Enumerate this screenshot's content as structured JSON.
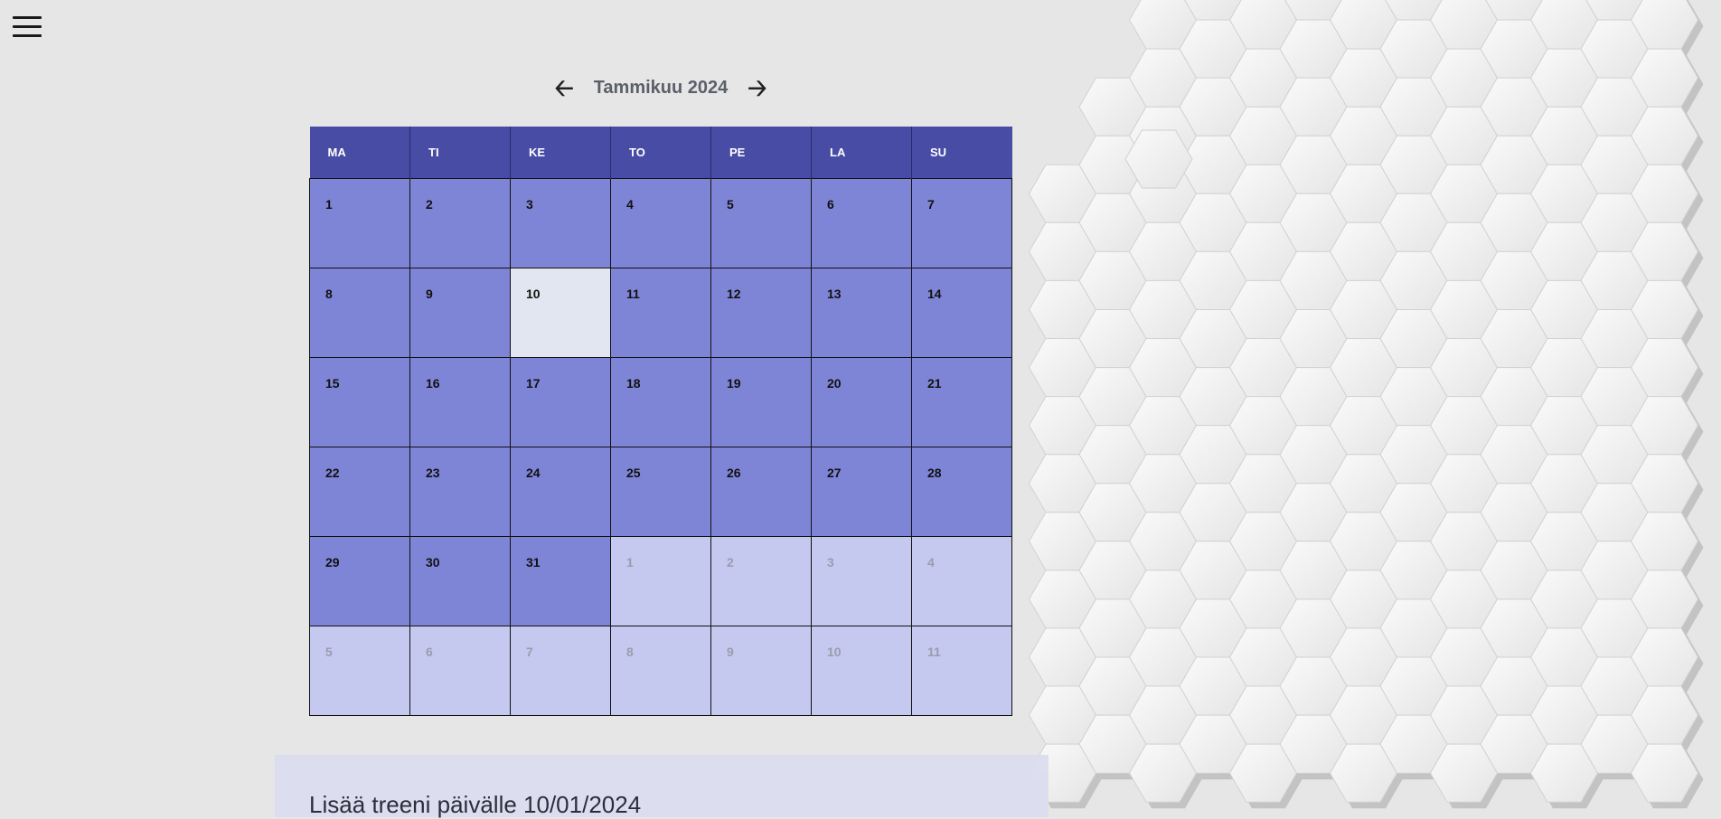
{
  "header": {
    "month_label": "Tammikuu 2024"
  },
  "calendar": {
    "weekdays": [
      "MA",
      "TI",
      "KE",
      "TO",
      "PE",
      "LA",
      "SU"
    ],
    "weeks": [
      [
        {
          "d": "1"
        },
        {
          "d": "2"
        },
        {
          "d": "3"
        },
        {
          "d": "4"
        },
        {
          "d": "5"
        },
        {
          "d": "6"
        },
        {
          "d": "7"
        }
      ],
      [
        {
          "d": "8"
        },
        {
          "d": "9"
        },
        {
          "d": "10",
          "today": true
        },
        {
          "d": "11"
        },
        {
          "d": "12"
        },
        {
          "d": "13"
        },
        {
          "d": "14"
        }
      ],
      [
        {
          "d": "15"
        },
        {
          "d": "16"
        },
        {
          "d": "17"
        },
        {
          "d": "18"
        },
        {
          "d": "19"
        },
        {
          "d": "20"
        },
        {
          "d": "21"
        }
      ],
      [
        {
          "d": "22"
        },
        {
          "d": "23"
        },
        {
          "d": "24"
        },
        {
          "d": "25"
        },
        {
          "d": "26"
        },
        {
          "d": "27"
        },
        {
          "d": "28"
        }
      ],
      [
        {
          "d": "29"
        },
        {
          "d": "30"
        },
        {
          "d": "31"
        },
        {
          "d": "1",
          "other": true
        },
        {
          "d": "2",
          "other": true
        },
        {
          "d": "3",
          "other": true
        },
        {
          "d": "4",
          "other": true
        }
      ],
      [
        {
          "d": "5",
          "other": true
        },
        {
          "d": "6",
          "other": true
        },
        {
          "d": "7",
          "other": true
        },
        {
          "d": "8",
          "other": true
        },
        {
          "d": "9",
          "other": true
        },
        {
          "d": "10",
          "other": true
        },
        {
          "d": "11",
          "other": true
        }
      ]
    ]
  },
  "add_panel": {
    "title": "Lisää treeni päivälle 10/01/2024"
  },
  "icons": {
    "menu": "hamburger-icon",
    "prev": "arrow-left-icon",
    "next": "arrow-right-icon"
  },
  "colors": {
    "header": "#484ca4",
    "day": "#7f85d6",
    "today": "#e2e6f0",
    "other_month": "#c5c8ef"
  }
}
